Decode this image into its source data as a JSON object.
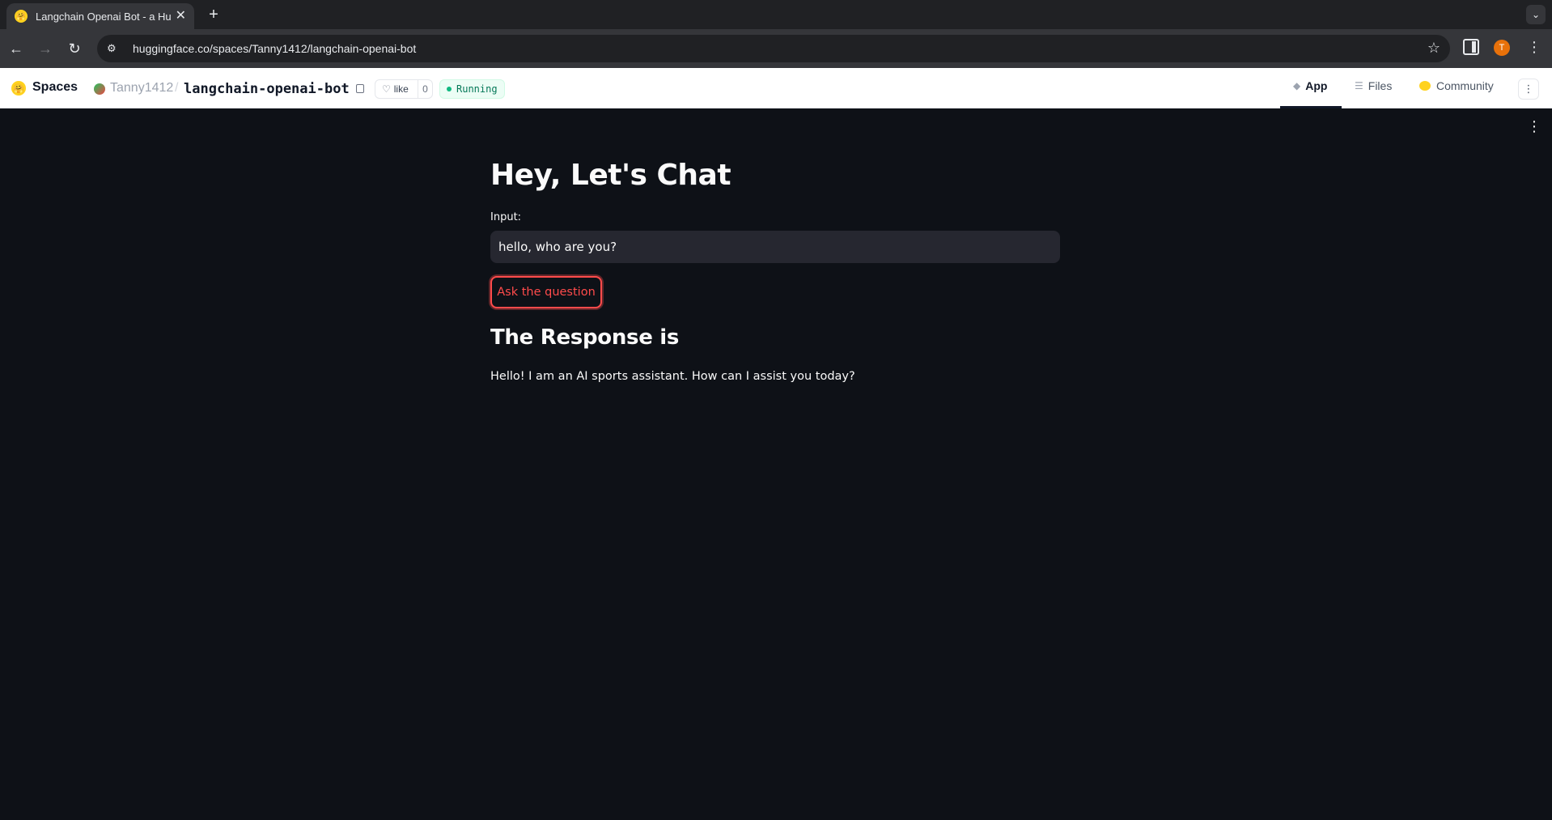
{
  "browser": {
    "tab_title": "Langchain Openai Bot - a Hug",
    "tab_close": "✕",
    "new_tab": "+",
    "tab_menu": "⌄",
    "url": "huggingface.co/spaces/Tanny1412/langchain-openai-bot",
    "profile_initial": "T",
    "back": "←",
    "forward": "→",
    "reload": "↻",
    "site_info": "⚙",
    "bookmark": "☆",
    "menu": "⋮"
  },
  "hf_header": {
    "brand": "Spaces",
    "owner": "Tanny1412",
    "separator": "/",
    "repo": "langchain-openai-bot",
    "like_label": "like",
    "like_count": "0",
    "status": "Running",
    "tabs": [
      {
        "label": "App",
        "icon": "cube-icon",
        "active": true
      },
      {
        "label": "Files",
        "icon": "files-icon",
        "active": false
      },
      {
        "label": "Community",
        "icon": "community-icon",
        "active": false
      }
    ],
    "more": "⋮"
  },
  "app": {
    "title": "Hey, Let's Chat",
    "input_label": "Input:",
    "input_value": "hello, who are you?",
    "button_label": "Ask the question",
    "response_title": "The Response is",
    "response_text": "Hello! I am an AI sports assistant. How can I assist you today?",
    "menu": "⋮"
  },
  "colors": {
    "app_bg": "#0e1117",
    "accent": "#ff4b4b",
    "input_bg": "#262730",
    "status_green": "#10b981"
  }
}
